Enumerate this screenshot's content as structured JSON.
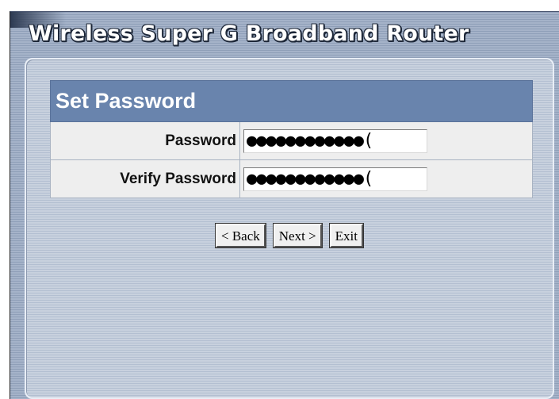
{
  "app": {
    "title": "Wireless Super G Broadband Router"
  },
  "form": {
    "heading": "Set Password",
    "password_label": "Password",
    "password_value": "●●●●●●●●●●●●(",
    "verify_label": "Verify Password",
    "verify_value": "●●●●●●●●●●●●("
  },
  "buttons": {
    "back_label": "< Back",
    "next_label": "Next >",
    "exit_label": "Exit"
  },
  "colors": {
    "header_bg": "#6984ad",
    "row_bg": "#eeeeee",
    "window_bg": "#a5b3c9"
  }
}
